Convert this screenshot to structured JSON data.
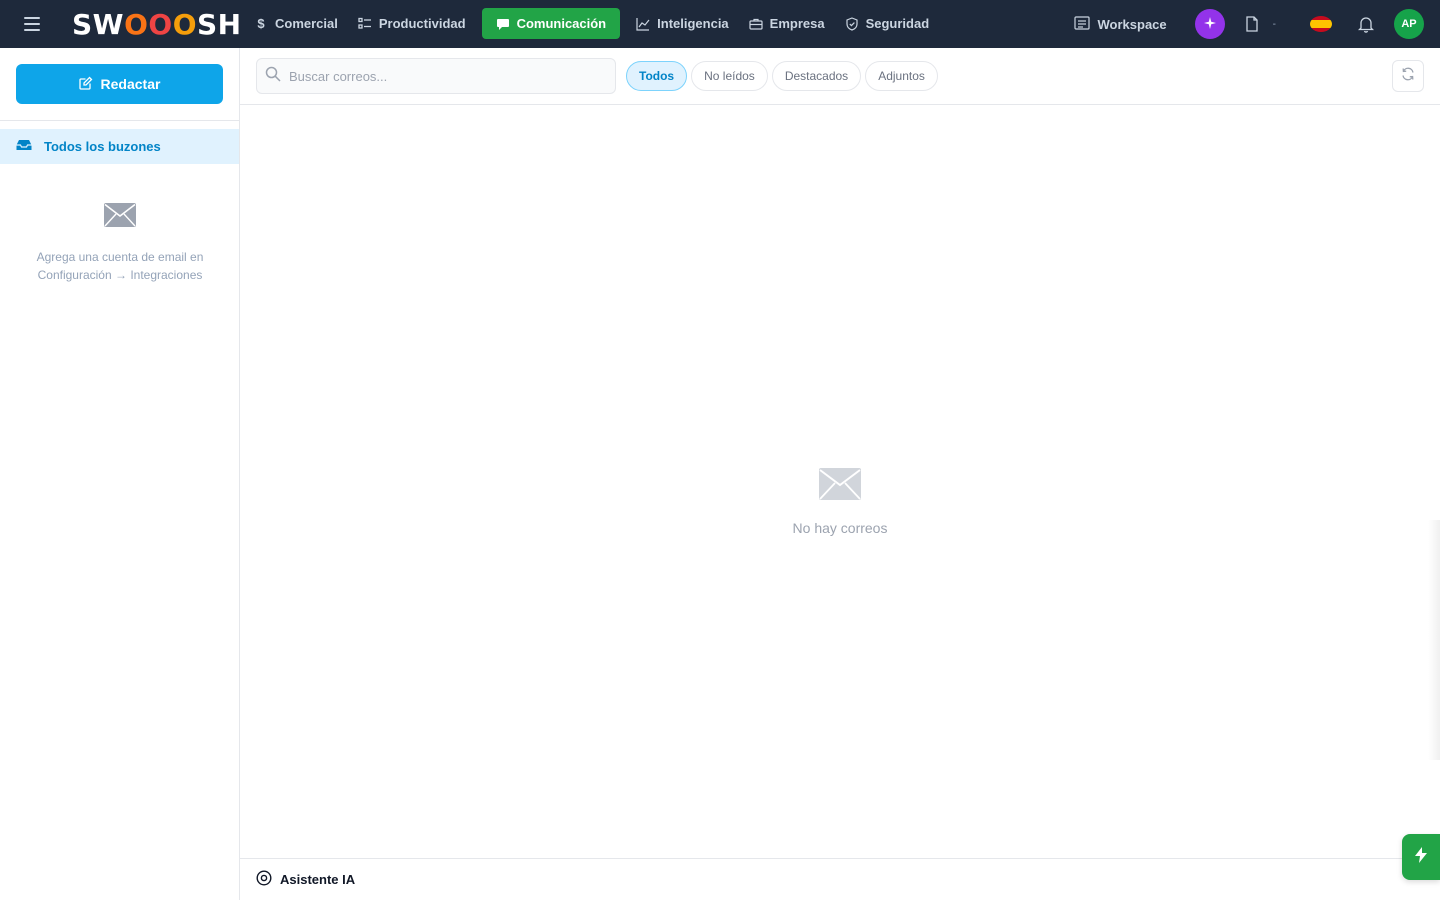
{
  "app": {
    "logo": {
      "part1": "SW",
      "o1": "O",
      "o2": "O",
      "o3": "O",
      "part2": "SH"
    }
  },
  "nav": {
    "items": [
      {
        "label": "Comercial",
        "icon": "dollar-icon"
      },
      {
        "label": "Productividad",
        "icon": "checklist-icon"
      },
      {
        "label": "Comunicación",
        "icon": "chat-icon",
        "active": true
      },
      {
        "label": "Inteligencia",
        "icon": "chart-line-icon"
      },
      {
        "label": "Empresa",
        "icon": "briefcase-icon"
      },
      {
        "label": "Seguridad",
        "icon": "shield-icon"
      }
    ]
  },
  "header_tools": {
    "workspace_label": "Workspace",
    "ai_icon": "sparkle-icon",
    "caret": "-",
    "language_flag": "spain-flag",
    "avatar_initials": "AP"
  },
  "sidebar": {
    "compose_label": "Redactar",
    "mailbox_label": "Todos los buzones",
    "empty_line1": "Agrega una cuenta de email en",
    "empty_line2": "Configuración → Integraciones"
  },
  "toolbar": {
    "search_placeholder": "Buscar correos...",
    "filters": [
      "Todos",
      "No leídos",
      "Destacados",
      "Adjuntos"
    ],
    "active_filter": "Todos"
  },
  "main": {
    "empty_text": "No hay correos"
  },
  "assistant": {
    "label": "Asistente IA"
  },
  "colors": {
    "topbar": "#1e293b",
    "active_nav": "#22a447",
    "compose": "#0ea5e9",
    "accent": "#0284c7",
    "ai_button": "#9333ea",
    "avatar": "#16a34a"
  }
}
